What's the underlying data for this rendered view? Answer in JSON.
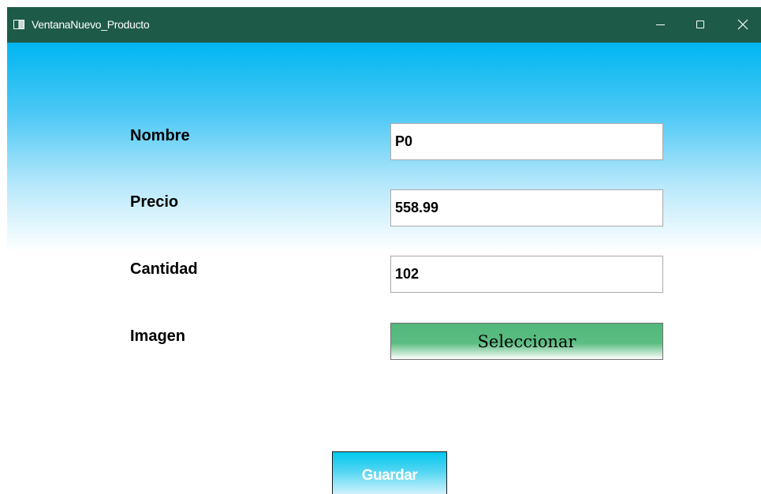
{
  "window": {
    "title": "VentanaNuevo_Producto",
    "icon": "window-app-icon",
    "titlebar_color": "#1e5a48"
  },
  "titlebar_controls": {
    "minimize_icon": "minimize-icon",
    "maximize_icon": "maximize-icon",
    "close_icon": "close-icon"
  },
  "form": {
    "nombre_label": "Nombre",
    "nombre_value": "P0",
    "precio_label": "Precio",
    "precio_value": "558.99",
    "cantidad_label": "Cantidad",
    "cantidad_value": "102",
    "imagen_label": "Imagen",
    "seleccionar_label": "Seleccionar"
  },
  "actions": {
    "guardar_label": "Guardar"
  },
  "colors": {
    "background_top": "#00b6f1",
    "seleccionar_green": "#52b87a",
    "guardar_cyan": "#00c8ee"
  }
}
